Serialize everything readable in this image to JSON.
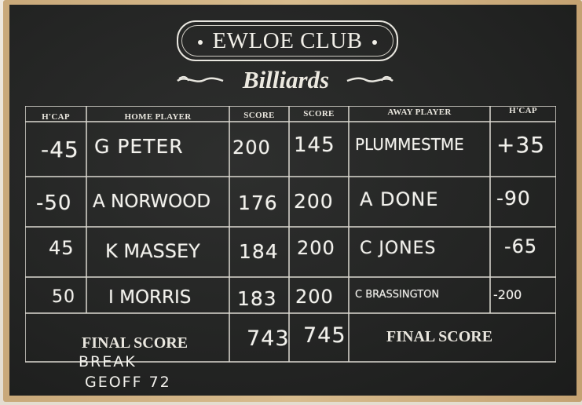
{
  "board": {
    "club_name": "EWLOE CLUB",
    "subtitle": "Billiards"
  },
  "headers": {
    "hcap_left": "H'CAP",
    "home_player": "HOME PLAYER",
    "score_left": "SCORE",
    "score_right": "SCORE",
    "away_player": "AWAY PLAYER",
    "hcap_right": "H'CAP"
  },
  "rows": [
    {
      "hcap_home": "-45",
      "home": "G PETER",
      "score_home": "200",
      "score_away": "145",
      "away": "PLUMMESTME",
      "hcap_away": "+35"
    },
    {
      "hcap_home": "-50",
      "home": "A NORWOOD",
      "score_home": "176",
      "score_away": "200",
      "away": "A DONE",
      "hcap_away": "-90"
    },
    {
      "hcap_home": "45",
      "home": "K MASSEY",
      "score_home": "184",
      "score_away": "200",
      "away": "C JONES",
      "hcap_away": "-65"
    },
    {
      "hcap_home": "50",
      "home": "I MORRIS",
      "score_home": "183",
      "score_away": "200",
      "away": "C BRASSINGTON",
      "hcap_away": "-200"
    }
  ],
  "final": {
    "left_label": "FINAL SCORE",
    "right_label": "FINAL SCORE",
    "home_total": "743",
    "away_total": "745"
  },
  "notes": {
    "break_label": "BREAK",
    "break_value": "GEOFF 72"
  }
}
